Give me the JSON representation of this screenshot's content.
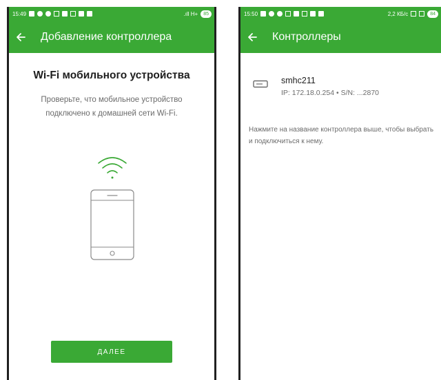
{
  "left_screen": {
    "status_bar": {
      "time": "15:49",
      "network_text": ".ıll H+",
      "battery": "85"
    },
    "app_bar": {
      "title": "Добавление контроллера",
      "back_icon": "arrow-back-icon"
    },
    "heading": "Wi-Fi мобильного устройства",
    "description": "Проверьте, что мобильное устройство подключено к домашней сети Wi-Fi.",
    "illustration_icons": [
      "wifi-signal-icon",
      "smartphone-icon"
    ],
    "next_button_label": "ДАЛЕЕ"
  },
  "right_screen": {
    "status_bar": {
      "time": "15:50",
      "speed": "2,2 КБ/с",
      "battery": "84"
    },
    "app_bar": {
      "title": "Контроллеры",
      "back_icon": "arrow-back-icon"
    },
    "controllers": [
      {
        "name": "smhc211",
        "info": "IP: 172.18.0.254 • S/N: ...2870",
        "icon": "router-icon"
      }
    ],
    "hint": "Нажмите на название контроллера выше, чтобы выбрать и подключиться к нему."
  },
  "colors": {
    "primary": "#3aa935",
    "text_primary": "#212121",
    "text_secondary": "#6b6b6b",
    "illustration_stroke": "#8a8a8a"
  }
}
